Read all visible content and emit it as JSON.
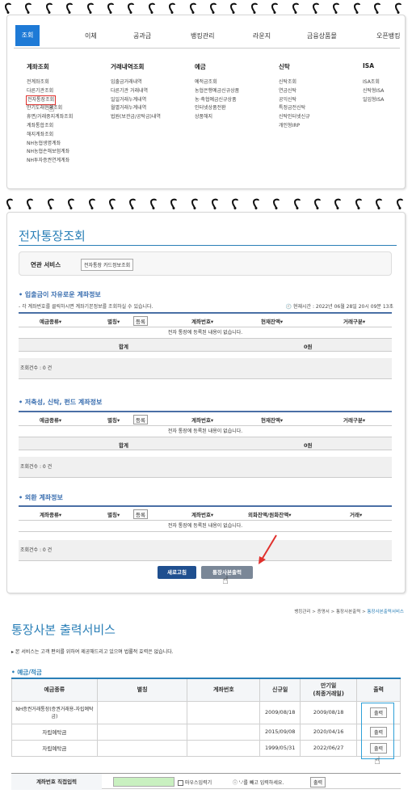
{
  "menu": {
    "tabs": [
      "조회",
      "이체",
      "공과금",
      "뱅킹관리",
      "라운지",
      "금융상품몰",
      "오픈뱅킹"
    ],
    "columns": [
      {
        "head": "계좌조회",
        "items": [
          "전계좌조회",
          "다른기관조회",
          "전자통장조회",
          "만기도래현황조회",
          "휴면/거래중지계좌조회",
          "계좌통합조회",
          "해지계좌조회",
          "NH농협생명계좌",
          "NH농협손해보험계좌",
          "NH투자증권연계계좌"
        ]
      },
      {
        "head": "거래내역조회",
        "items": [
          "입출금거래내역",
          "다른기관 거래내역",
          "일일거래누계내역",
          "월별거래누계내역",
          "법원(보관금/공탁금)내역"
        ]
      },
      {
        "head": "예금",
        "items": [
          "예적금조회",
          "농협은행예금신규상품",
          "농·축협예금신규상품",
          "인터넷상품전환",
          "상품해지"
        ]
      },
      {
        "head": "신탁",
        "items": [
          "신탁조회",
          "연금신탁",
          "공익신탁",
          "특정금전신탁",
          "신탁인터넷신규",
          "개인형IRP"
        ]
      },
      {
        "head": "ISA",
        "items": [
          "ISA조회",
          "신탁형ISA",
          "일임형ISA"
        ]
      }
    ]
  },
  "estatement": {
    "title": "전자통장조회",
    "service_label": "연관 서비스",
    "service_button": "전자통장 카드정보조회",
    "note": "- 각 계좌번호를 클릭하시면 계좌기본정보를 조회하실 수 있습니다.",
    "time": "현재시간 : 2022년 06월 28일 20시 09분 13초",
    "sections": [
      {
        "title": "입출금이 자유로운 계좌정보",
        "headers": [
          "예금종류▾",
          "별칭▾",
          "등록",
          "계좌번호▾",
          "현재잔액▾",
          "거래구분▾"
        ],
        "empty": "전자 통장에 등록된 내용이 없습니다.",
        "total_label": "합계",
        "total_value": "0원",
        "count": "조회건수 : 0 건"
      },
      {
        "title": "저축성, 신탁, 펀드 계좌정보",
        "headers": [
          "예금종류▾",
          "별칭▾",
          "등록",
          "계좌번호▾",
          "현재잔액▾",
          "거래구분▾"
        ],
        "empty": "전자 통장에 등록된 내용이 없습니다.",
        "total_label": "합계",
        "total_value": "0원",
        "count": "조회건수 : 0 건"
      },
      {
        "title": "외환 계좌정보",
        "headers": [
          "계좌종류▾",
          "별칭▾",
          "등록",
          "계좌번호▾",
          "외화잔액/원화잔액▾",
          "거래▾"
        ],
        "empty": "전자 통장에 등록된 내용이 없습니다.",
        "count": "조회건수 : 0 건"
      }
    ],
    "refresh_button": "새로고침",
    "print_button": "통장사본출력"
  },
  "copy_service": {
    "breadcrumb": [
      "뱅킹관리",
      "증명서",
      "통장사본출력",
      "통장사본출력서비스"
    ],
    "title": "통장사본 출력서비스",
    "note": "본 서비스는 고객 편의를 위하여 제공해드리고 있으며 법률적 효력은 없습니다.",
    "section": "예금/적금",
    "headers": [
      "예금종류",
      "별칭",
      "계좌번호",
      "신규일",
      "만기일\n(최종거래일)",
      "출력"
    ],
    "rows": [
      {
        "type": "NH증권거래통장(증권거래용-자립예탁금)",
        "alias": "",
        "account": "",
        "opened": "2009/08/18",
        "maturity": "2009/08/18",
        "out": "출력"
      },
      {
        "type": "자립예탁금",
        "alias": "",
        "account": "",
        "opened": "2015/09/08",
        "maturity": "2020/04/16",
        "out": "출력"
      },
      {
        "type": "자립예탁금",
        "alias": "",
        "account": "",
        "opened": "1999/05/31",
        "maturity": "2022/06/27",
        "out": "출력"
      }
    ],
    "direct_label": "계좌번호 직접입력",
    "mouse_input": "마우스입력기",
    "info": "'-'를 빼고 입력하세요.",
    "direct_button": "출력"
  },
  "colors": {
    "accent": "#1e7ad6",
    "title": "#2a7fb7",
    "highlight_red": "#e0302c",
    "highlight_blue": "#2ea0d8",
    "refresh_btn": "#1f4f8f",
    "print_btn": "#7a8797"
  }
}
